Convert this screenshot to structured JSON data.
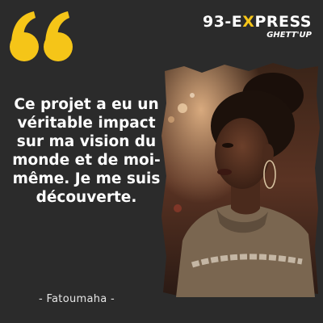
{
  "brand": {
    "name_prefix": "93-E",
    "name_accent": "X",
    "name_suffix": "PRESS",
    "subtitle": "GHETT'UP"
  },
  "quote": {
    "text": "Ce projet a eu un véritable impact sur ma vision du monde et de moi-même. Je me suis découverte.",
    "author": "- Fatoumaha -"
  },
  "colors": {
    "background": "#2b2b2b",
    "accent": "#f5c518",
    "text": "#ffffff"
  },
  "icons": {
    "quote_mark": "double-quote-icon"
  }
}
